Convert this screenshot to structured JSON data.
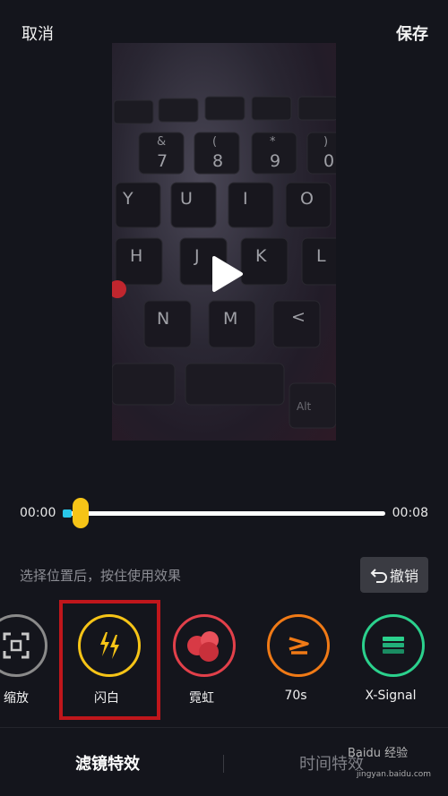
{
  "topbar": {
    "cancel_label": "取消",
    "save_label": "保存"
  },
  "preview": {
    "keys": {
      "row1": [
        "&",
        "(",
        "*",
        ")"
      ],
      "row1b": [
        "7",
        "8",
        "9",
        "0"
      ],
      "row2": [
        "Y",
        "U",
        "I",
        "O"
      ],
      "row3": [
        "H",
        "J",
        "K",
        "L"
      ],
      "row4": [
        "N",
        "M",
        "<"
      ],
      "alt": "Alt"
    }
  },
  "timeline": {
    "start_time": "00:00",
    "end_time": "00:08",
    "progress": 0.05
  },
  "hint": "选择位置后，按住使用效果",
  "undo": {
    "icon": "undo-arrow-icon",
    "label": "撤销"
  },
  "effects": [
    {
      "label": "缩放",
      "icon": "zoom-frame-icon",
      "color": "#8a8a8a"
    },
    {
      "label": "闪白",
      "icon": "lightning-icon",
      "color": "#f6c417"
    },
    {
      "label": "霓虹",
      "icon": "neon-circles-icon",
      "color": "#e2404a"
    },
    {
      "label": "70s",
      "icon": "seventies-icon",
      "color": "#f07a16"
    },
    {
      "label": "X-Signal",
      "icon": "signal-bars-icon",
      "color": "#2bd18d"
    }
  ],
  "selected_effect": "闪白",
  "tabs": {
    "filter_effects": "滤镜特效",
    "time_effects": "时间特效"
  },
  "watermark": {
    "brand": "Baidu 经验",
    "url": "jingyan.baidu.com"
  }
}
